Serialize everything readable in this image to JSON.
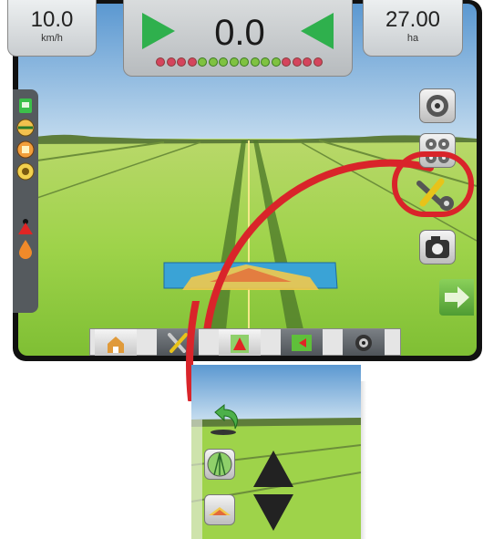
{
  "speed": {
    "value": "10.0",
    "unit": "km/h"
  },
  "area": {
    "value": "27.00",
    "unit": "ha"
  },
  "guidance": {
    "cross_track": "0.0"
  },
  "colors": {
    "guidance_green": "#2fb04d",
    "callout_red": "#d9242a",
    "led_red": "#d4455d",
    "led_green": "#7fc241",
    "sky": "#7fb2dc",
    "field": "#9ed34a"
  },
  "icons": {
    "left_bar": [
      "tractor-icon",
      "boom-level-icon",
      "section-status-icon",
      "gps-status-icon",
      "warning-triangle-icon",
      "fluid-drop-icon"
    ],
    "right_bar": [
      "camera-icon",
      "view-mode-icon",
      "tools-icon",
      "screenshot-icon",
      "next-arrow-icon"
    ],
    "bottom_bar": [
      "home-icon",
      "tools-icon",
      "guidance-icon",
      "map-icon",
      "camera-icon"
    ],
    "callout": [
      "back-arrow-icon",
      "perspective-view-icon",
      "lightbar-icon",
      "zoom-up-icon",
      "zoom-down-icon"
    ]
  }
}
